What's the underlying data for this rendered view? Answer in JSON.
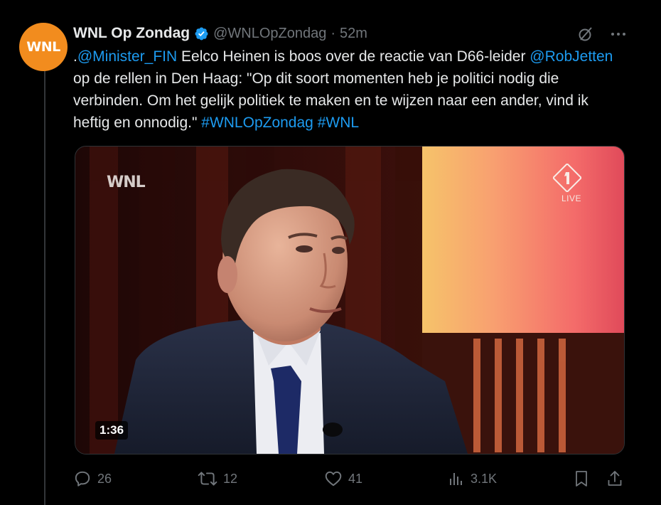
{
  "author": {
    "avatar_text": "WNL",
    "name": "WNL Op Zondag",
    "handle": "@WNLOpZondag",
    "separator": "·",
    "time": "52m",
    "avatar_color": "#f28c1e",
    "verified_color": "#1d9bf0"
  },
  "tweet": {
    "prefix": ".",
    "mention_1": "@Minister_FIN",
    "text_1": " Eelco Heinen is boos over de reactie van D66-leider ",
    "mention_2": "@RobJetten",
    "text_2": " op de rellen in Den Haag: \"Op dit soort momenten heb je politici nodig die verbinden. Om het gelijk politiek te maken en te wijzen naar een ander, vind ik heftig en onnodig.\" ",
    "hashtag_1": "#WNLOpZondag",
    "space": " ",
    "hashtag_2": "#WNL",
    "link_color": "#1d9bf0"
  },
  "media": {
    "broadcaster_logo": "WNL",
    "channel_logo": "npo-1-logo",
    "live_label": "LIVE",
    "duration": "1:36"
  },
  "actions": {
    "replies": "26",
    "reposts": "12",
    "likes": "41",
    "views": "3.1K",
    "icon_color": "#71767b"
  }
}
